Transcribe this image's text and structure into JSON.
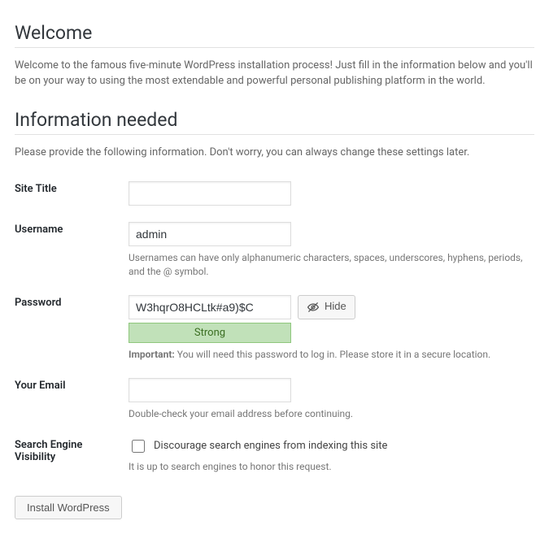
{
  "headings": {
    "welcome": "Welcome",
    "info_needed": "Information needed"
  },
  "intro": "Welcome to the famous five-minute WordPress installation process! Just fill in the information below and you'll be on your way to using the most extendable and powerful personal publishing platform in the world.",
  "info_instruction": "Please provide the following information. Don't worry, you can always change these settings later.",
  "fields": {
    "site_title": {
      "label": "Site Title",
      "value": ""
    },
    "username": {
      "label": "Username",
      "value": "admin",
      "hint": "Usernames can have only alphanumeric characters, spaces, underscores, hyphens, periods, and the @ symbol."
    },
    "password": {
      "label": "Password",
      "value": "W3hqrO8HCLtk#a9)$C",
      "hide_button": "Hide",
      "strength": "Strong",
      "important_label": "Important:",
      "important_text": " You will need this password to log in. Please store it in a secure location."
    },
    "email": {
      "label": "Your Email",
      "value": "",
      "hint": "Double-check your email address before continuing."
    },
    "search_visibility": {
      "label": "Search Engine Visibility",
      "checkbox_label": "Discourage search engines from indexing this site",
      "checked": false,
      "hint": "It is up to search engines to honor this request."
    }
  },
  "install_button": "Install WordPress"
}
